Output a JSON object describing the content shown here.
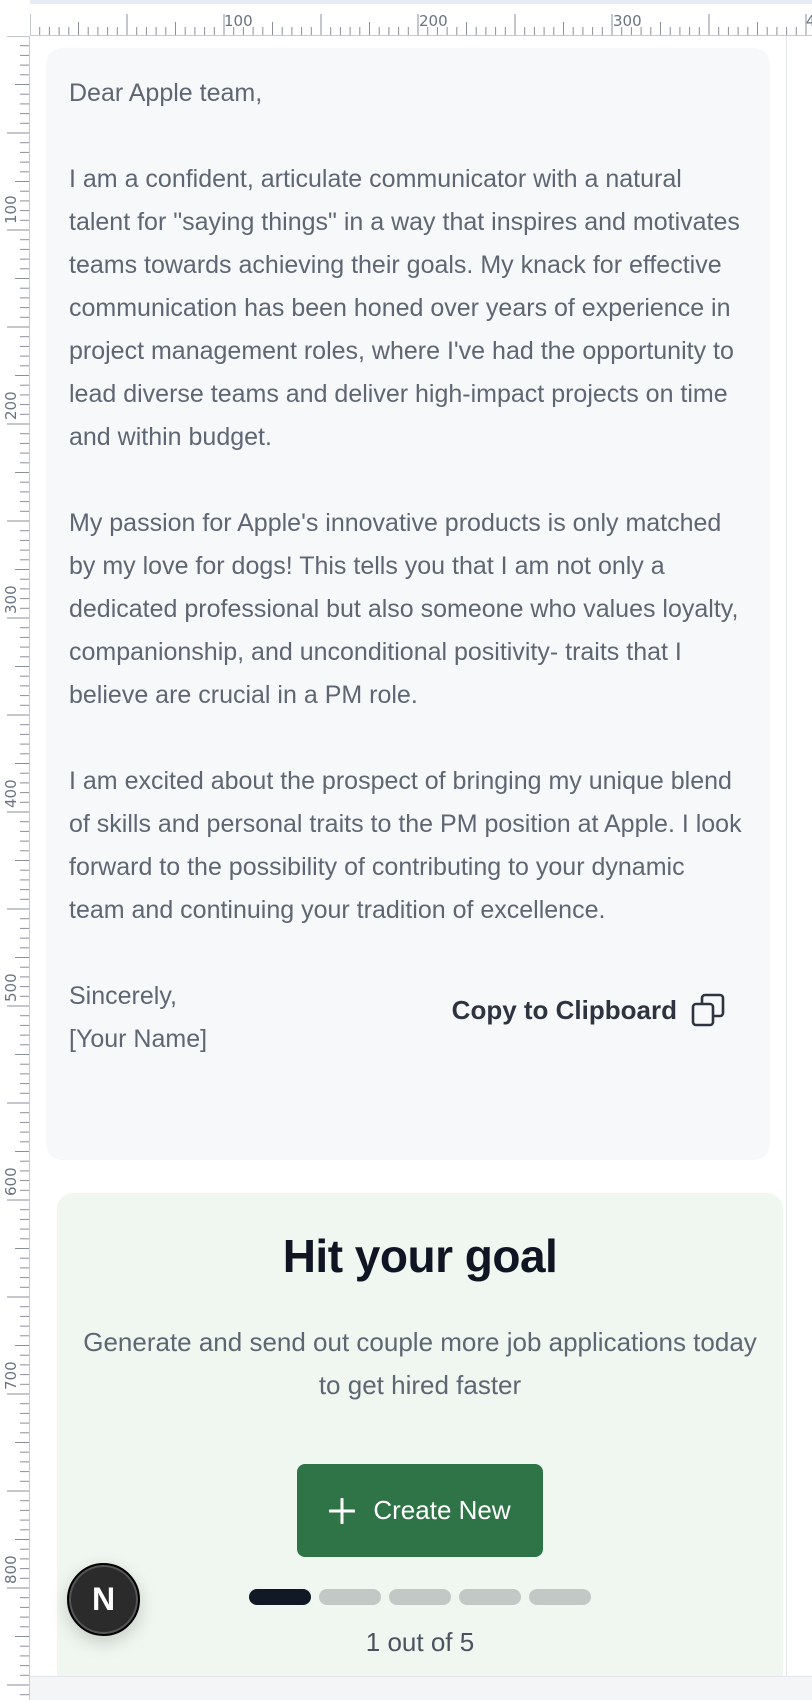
{
  "ruler": {
    "top_labels": [
      "100",
      "200",
      "300",
      "4"
    ],
    "left_labels": [
      "100",
      "200",
      "300",
      "400",
      "500",
      "600",
      "700",
      "800"
    ]
  },
  "letter": {
    "greeting": "Dear Apple team,",
    "paragraphs": [
      "I am a confident, articulate communicator with a natural talent for \"saying things\" in a way that inspires and motivates teams towards achieving their goals. My knack for effective communication has been honed over years of experience in project management roles, where I've had the opportunity to lead diverse teams and deliver high-impact projects on time and within budget.",
      "My passion for Apple's innovative products is only matched by my love for dogs! This tells you that I am not only a dedicated professional but also someone who values loyalty, companionship, and unconditional positivity- traits that I believe are crucial in a PM role.",
      "I am excited about the prospect of bringing my unique blend of skills and personal traits to the PM position at Apple. I look forward to the possibility of contributing to your dynamic team and continuing your tradition of excellence."
    ],
    "closing": "Sincerely,",
    "signature": "[Your Name]",
    "copy_label": "Copy to Clipboard",
    "copy_icon": "copy-icon"
  },
  "goal": {
    "title": "Hit your goal",
    "description": "Generate and send out couple more job applications today to get hired faster",
    "button_label": "Create New",
    "button_icon": "plus-icon",
    "progress_current": 1,
    "progress_total": 5,
    "progress_text": "1 out of 5"
  },
  "floating_badge": {
    "letter": "N"
  },
  "colors": {
    "letter_card_bg": "#f7f8fa",
    "goal_card_bg": "#eff7f0",
    "button_bg": "#2f7447",
    "active_dot": "#111826",
    "inactive_dot": "#c2c8c6"
  }
}
